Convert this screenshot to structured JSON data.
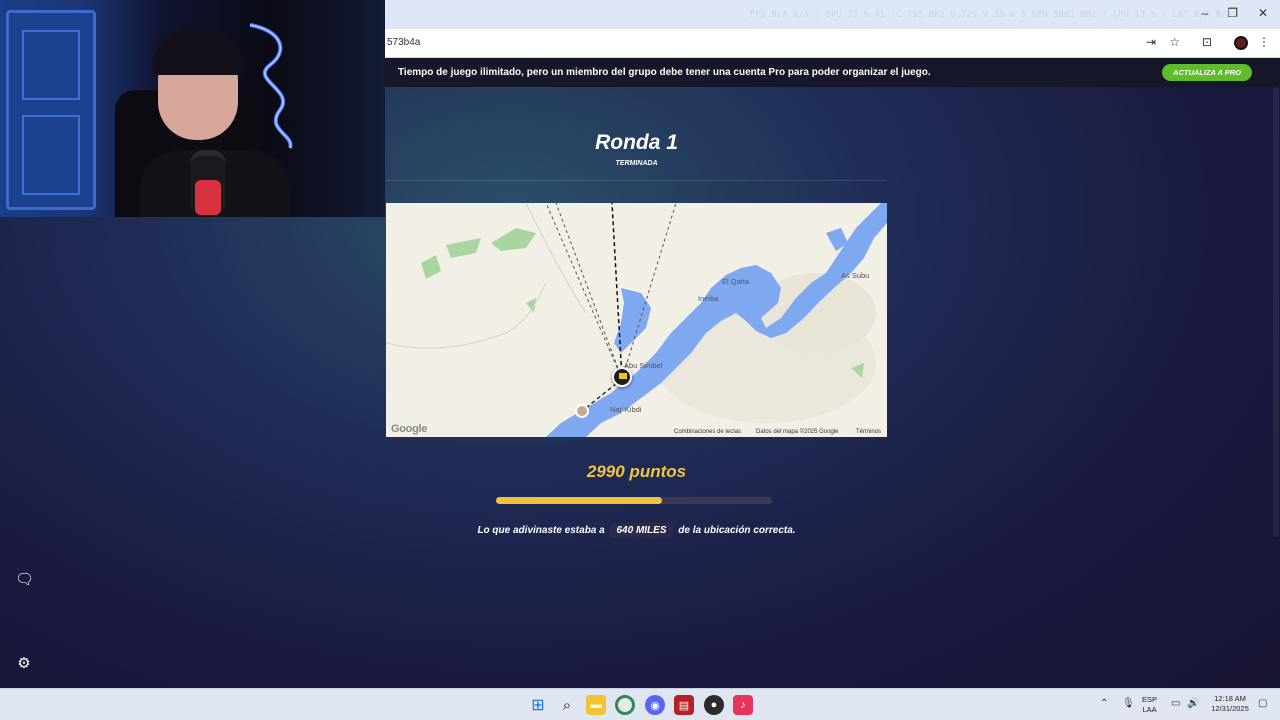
{
  "overlay": {
    "stats": "FPS N/A N/A | GPU 23 % 41 °C 795 MHz 0.725 V 39 W 0 RPM 5001 MHz | CPU 13 % | LAT N/A N/A"
  },
  "browser": {
    "url": "573b4a"
  },
  "banner": {
    "text": "Tiempo de juego ilimitado, pero un miembro del grupo debe tener una cuenta Pro para poder organizar el juego.",
    "button": "ACTUALIZA A PRO"
  },
  "round": {
    "title": "Ronda 1",
    "status": "TERMINADA"
  },
  "map": {
    "labels": [
      "As Subu",
      "El Qatta",
      "Ineiba",
      "Abu Simbel",
      "Naj' Kibdi"
    ],
    "footer_shortcuts": "Combinaciones de teclas",
    "footer_data": "Datos del mapa ©2025 Google",
    "footer_terms": "Términos",
    "logo": "Google"
  },
  "result": {
    "points": "2990 puntos",
    "progress_fraction": 0.6,
    "distance_prefix": "Lo que adivinaste estaba a",
    "distance_value": "640 MILES",
    "distance_suffix": "de la ubicación correcta."
  },
  "taskbar": {
    "lang_top": "ESP",
    "lang_bottom": "LAA",
    "time": "12:18 AM",
    "date": "12/31/2025"
  },
  "colors": {
    "accent": "#f1c540",
    "pro_green": "#5fbc2d",
    "water": "#7ea8f0"
  }
}
